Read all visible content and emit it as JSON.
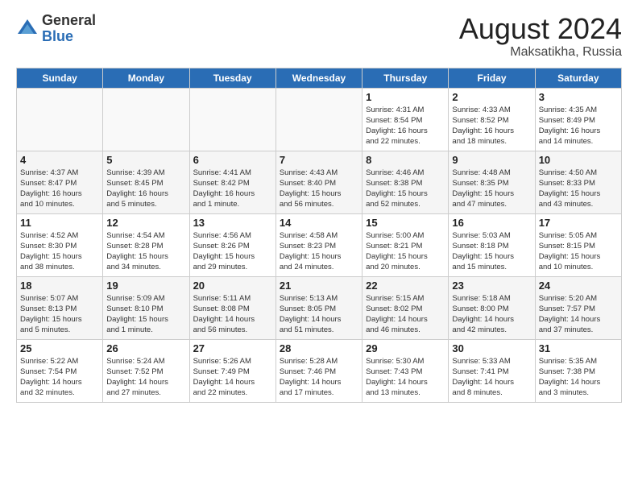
{
  "logo": {
    "general": "General",
    "blue": "Blue"
  },
  "title": {
    "month_year": "August 2024",
    "location": "Maksatikha, Russia"
  },
  "days_of_week": [
    "Sunday",
    "Monday",
    "Tuesday",
    "Wednesday",
    "Thursday",
    "Friday",
    "Saturday"
  ],
  "weeks": [
    [
      {
        "day": "",
        "info": ""
      },
      {
        "day": "",
        "info": ""
      },
      {
        "day": "",
        "info": ""
      },
      {
        "day": "",
        "info": ""
      },
      {
        "day": "1",
        "info": "Sunrise: 4:31 AM\nSunset: 8:54 PM\nDaylight: 16 hours\nand 22 minutes."
      },
      {
        "day": "2",
        "info": "Sunrise: 4:33 AM\nSunset: 8:52 PM\nDaylight: 16 hours\nand 18 minutes."
      },
      {
        "day": "3",
        "info": "Sunrise: 4:35 AM\nSunset: 8:49 PM\nDaylight: 16 hours\nand 14 minutes."
      }
    ],
    [
      {
        "day": "4",
        "info": "Sunrise: 4:37 AM\nSunset: 8:47 PM\nDaylight: 16 hours\nand 10 minutes."
      },
      {
        "day": "5",
        "info": "Sunrise: 4:39 AM\nSunset: 8:45 PM\nDaylight: 16 hours\nand 5 minutes."
      },
      {
        "day": "6",
        "info": "Sunrise: 4:41 AM\nSunset: 8:42 PM\nDaylight: 16 hours\nand 1 minute."
      },
      {
        "day": "7",
        "info": "Sunrise: 4:43 AM\nSunset: 8:40 PM\nDaylight: 15 hours\nand 56 minutes."
      },
      {
        "day": "8",
        "info": "Sunrise: 4:46 AM\nSunset: 8:38 PM\nDaylight: 15 hours\nand 52 minutes."
      },
      {
        "day": "9",
        "info": "Sunrise: 4:48 AM\nSunset: 8:35 PM\nDaylight: 15 hours\nand 47 minutes."
      },
      {
        "day": "10",
        "info": "Sunrise: 4:50 AM\nSunset: 8:33 PM\nDaylight: 15 hours\nand 43 minutes."
      }
    ],
    [
      {
        "day": "11",
        "info": "Sunrise: 4:52 AM\nSunset: 8:30 PM\nDaylight: 15 hours\nand 38 minutes."
      },
      {
        "day": "12",
        "info": "Sunrise: 4:54 AM\nSunset: 8:28 PM\nDaylight: 15 hours\nand 34 minutes."
      },
      {
        "day": "13",
        "info": "Sunrise: 4:56 AM\nSunset: 8:26 PM\nDaylight: 15 hours\nand 29 minutes."
      },
      {
        "day": "14",
        "info": "Sunrise: 4:58 AM\nSunset: 8:23 PM\nDaylight: 15 hours\nand 24 minutes."
      },
      {
        "day": "15",
        "info": "Sunrise: 5:00 AM\nSunset: 8:21 PM\nDaylight: 15 hours\nand 20 minutes."
      },
      {
        "day": "16",
        "info": "Sunrise: 5:03 AM\nSunset: 8:18 PM\nDaylight: 15 hours\nand 15 minutes."
      },
      {
        "day": "17",
        "info": "Sunrise: 5:05 AM\nSunset: 8:15 PM\nDaylight: 15 hours\nand 10 minutes."
      }
    ],
    [
      {
        "day": "18",
        "info": "Sunrise: 5:07 AM\nSunset: 8:13 PM\nDaylight: 15 hours\nand 5 minutes."
      },
      {
        "day": "19",
        "info": "Sunrise: 5:09 AM\nSunset: 8:10 PM\nDaylight: 15 hours\nand 1 minute."
      },
      {
        "day": "20",
        "info": "Sunrise: 5:11 AM\nSunset: 8:08 PM\nDaylight: 14 hours\nand 56 minutes."
      },
      {
        "day": "21",
        "info": "Sunrise: 5:13 AM\nSunset: 8:05 PM\nDaylight: 14 hours\nand 51 minutes."
      },
      {
        "day": "22",
        "info": "Sunrise: 5:15 AM\nSunset: 8:02 PM\nDaylight: 14 hours\nand 46 minutes."
      },
      {
        "day": "23",
        "info": "Sunrise: 5:18 AM\nSunset: 8:00 PM\nDaylight: 14 hours\nand 42 minutes."
      },
      {
        "day": "24",
        "info": "Sunrise: 5:20 AM\nSunset: 7:57 PM\nDaylight: 14 hours\nand 37 minutes."
      }
    ],
    [
      {
        "day": "25",
        "info": "Sunrise: 5:22 AM\nSunset: 7:54 PM\nDaylight: 14 hours\nand 32 minutes."
      },
      {
        "day": "26",
        "info": "Sunrise: 5:24 AM\nSunset: 7:52 PM\nDaylight: 14 hours\nand 27 minutes."
      },
      {
        "day": "27",
        "info": "Sunrise: 5:26 AM\nSunset: 7:49 PM\nDaylight: 14 hours\nand 22 minutes."
      },
      {
        "day": "28",
        "info": "Sunrise: 5:28 AM\nSunset: 7:46 PM\nDaylight: 14 hours\nand 17 minutes."
      },
      {
        "day": "29",
        "info": "Sunrise: 5:30 AM\nSunset: 7:43 PM\nDaylight: 14 hours\nand 13 minutes."
      },
      {
        "day": "30",
        "info": "Sunrise: 5:33 AM\nSunset: 7:41 PM\nDaylight: 14 hours\nand 8 minutes."
      },
      {
        "day": "31",
        "info": "Sunrise: 5:35 AM\nSunset: 7:38 PM\nDaylight: 14 hours\nand 3 minutes."
      }
    ]
  ]
}
